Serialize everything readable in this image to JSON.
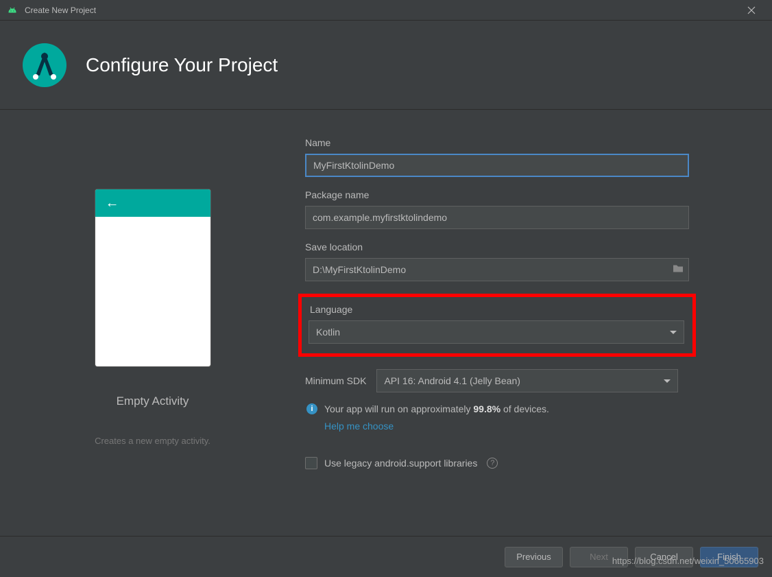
{
  "titlebar": {
    "title": "Create New Project"
  },
  "header": {
    "title": "Configure Your Project"
  },
  "preview": {
    "title": "Empty Activity",
    "description": "Creates a new empty activity."
  },
  "form": {
    "name_label": "Name",
    "name_value": "MyFirstKtolinDemo",
    "package_label": "Package name",
    "package_value": "com.example.myfirstktolindemo",
    "location_label": "Save location",
    "location_value": "D:\\MyFirstKtolinDemo",
    "language_label": "Language",
    "language_value": "Kotlin",
    "minsdk_label": "Minimum SDK",
    "minsdk_value": "API 16: Android 4.1 (Jelly Bean)",
    "info_prefix": "Your app will run on approximately ",
    "info_pct": "99.8%",
    "info_suffix": " of devices.",
    "info_link": "Help me choose",
    "legacy_label": "Use legacy android.support libraries"
  },
  "footer": {
    "previous": "Previous",
    "next": "Next",
    "cancel": "Cancel",
    "finish": "Finish"
  },
  "watermark": "https://blog.csdn.net/weixin_50665903"
}
